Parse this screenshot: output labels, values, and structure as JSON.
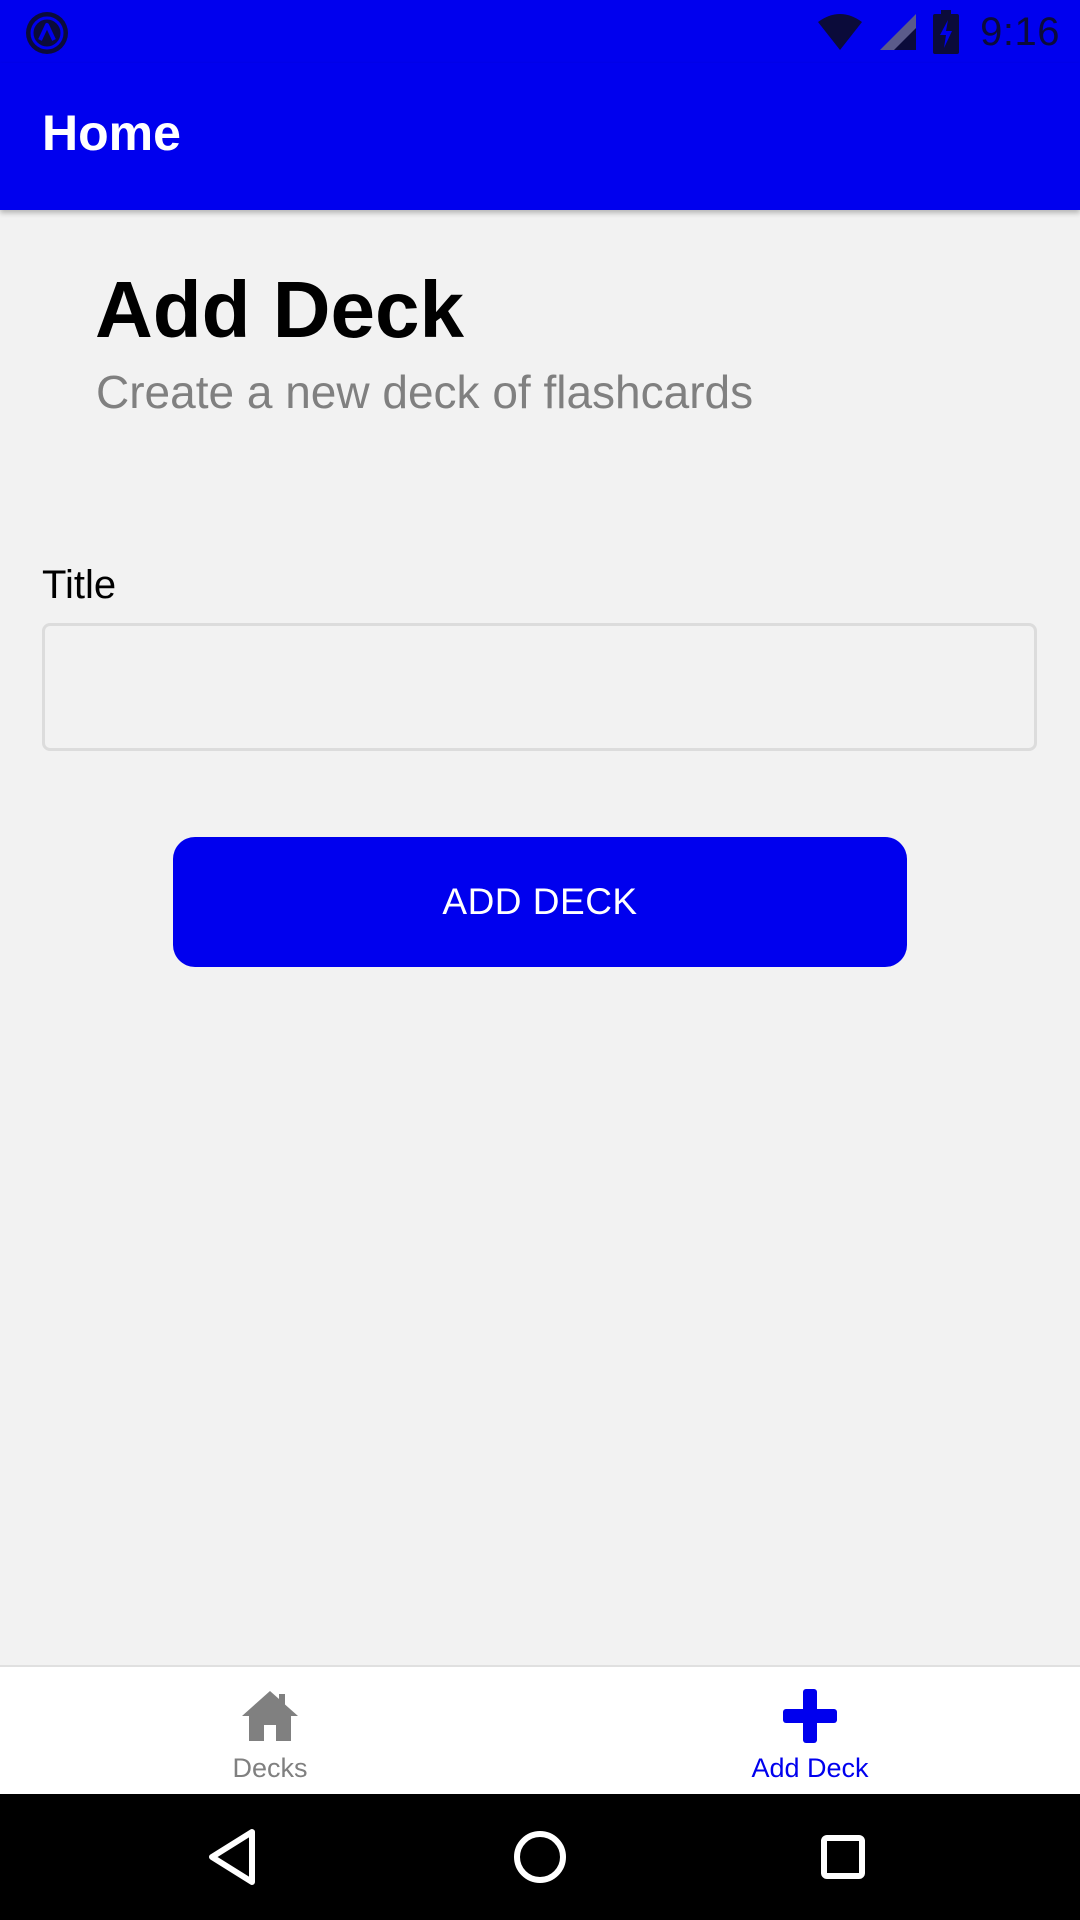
{
  "status_bar": {
    "time": "9:16",
    "left_icon": "react-native-app-icon",
    "icons": [
      "wifi-icon",
      "cellular-signal-icon",
      "battery-charging-icon"
    ]
  },
  "app_bar": {
    "title": "Home"
  },
  "main": {
    "heading": "Add Deck",
    "subtitle": "Create a new deck of flashcards",
    "title_field": {
      "label": "Title",
      "value": "",
      "placeholder": ""
    },
    "submit_label": "ADD DECK"
  },
  "tabs": [
    {
      "label": "Decks",
      "icon": "home-icon",
      "active": false
    },
    {
      "label": "Add Deck",
      "icon": "plus-icon",
      "active": true
    }
  ],
  "nav_bar": {
    "buttons": [
      "back-icon",
      "home-circle-icon",
      "recents-icon"
    ]
  },
  "colors": {
    "primary": "#0000ee",
    "background": "#f2f2f2",
    "inactive_tab": "#808080",
    "subtitle": "#808080"
  }
}
